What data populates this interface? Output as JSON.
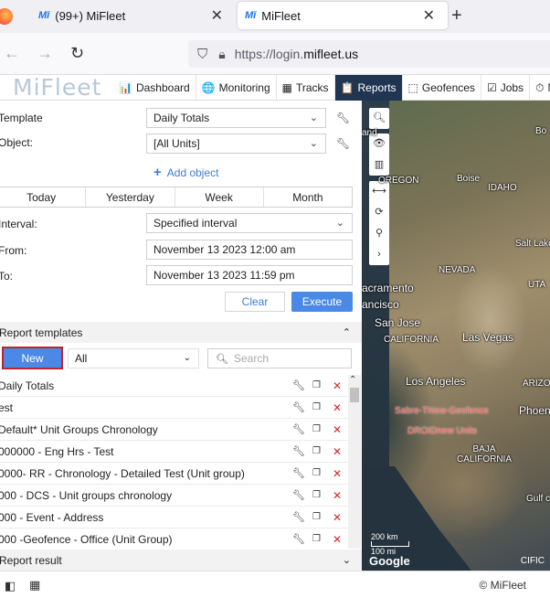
{
  "browser": {
    "tabs": [
      {
        "label": "(99+) MiFleet",
        "close": "✕"
      },
      {
        "label": "MiFleet",
        "close": "✕"
      }
    ],
    "new_tab": "+",
    "url_prefix": "https://login.",
    "url_domain": "mifleet.us"
  },
  "app": {
    "brand": "MiFleet",
    "menu": [
      {
        "icon": "bar-chart-icon",
        "glyph": "📊",
        "label": "Dashboard"
      },
      {
        "icon": "globe-icon",
        "glyph": "🌐",
        "label": "Monitoring"
      },
      {
        "icon": "tracks-icon",
        "glyph": "▦",
        "label": "Tracks"
      },
      {
        "icon": "reports-icon",
        "glyph": "📋",
        "label": "Reports"
      },
      {
        "icon": "geofences-icon",
        "glyph": "⬚",
        "label": "Geofences"
      },
      {
        "icon": "jobs-icon",
        "glyph": "☑",
        "label": "Jobs"
      },
      {
        "icon": "clock-icon",
        "glyph": "⏱",
        "label": "No"
      }
    ],
    "active_menu": "Reports"
  },
  "form": {
    "template_label": "Template",
    "template_value": "Daily Totals",
    "object_label": "Object:",
    "object_value": "[All Units]",
    "add_object": "Add object",
    "periods": [
      "Today",
      "Yesterday",
      "Week",
      "Month"
    ],
    "interval_label": "Interval:",
    "interval_value": "Specified interval",
    "from_label": "From:",
    "from_value": "November 13 2023 12:00 am",
    "to_label": "To:",
    "to_value": "November 13 2023 11:59 pm",
    "clear": "Clear",
    "execute": "Execute"
  },
  "templates": {
    "header": "Report templates",
    "new": "New",
    "filter": "All",
    "search_placeholder": "Search",
    "items": [
      "Daily Totals",
      "est",
      "Default* Unit Groups Chronology",
      "000000 - Eng Hrs - Test",
      "0000- RR - Chronology - Detailed Test (Unit group)",
      "000 - DCS - Unit groups chronology",
      "000 - Event - Address",
      "000 -Geofence - Office (Unit Group)"
    ]
  },
  "result": {
    "header": "Report result"
  },
  "map": {
    "labels": {
      "oregon": "OREGON",
      "boise": "Boise",
      "idaho": "IDAHO",
      "salt_lake": "Salt Lake",
      "nevada": "NEVADA",
      "utah": "UTA",
      "sacramento": "acramento",
      "sf": "ancisco",
      "san_jose": "San Jose",
      "california": "CALIFORNIA",
      "las_vegas": "Las Vegas",
      "los_angeles": "Los Angeles",
      "arizona": "ARIZO",
      "phoenix": "Phoen",
      "baja": "BAJA CALIFORNIA",
      "gulf": "Gulf c",
      "geofence1": "Sabre-TNew-Geofence",
      "geofence2": "DROIDnew Units",
      "portland": "and",
      "bo": "Bo"
    },
    "scale1": "200 km",
    "scale2": "100 mi",
    "google": "Google",
    "copyright": "CIFIC"
  },
  "footer": {
    "copyright": "© MiFleet"
  }
}
